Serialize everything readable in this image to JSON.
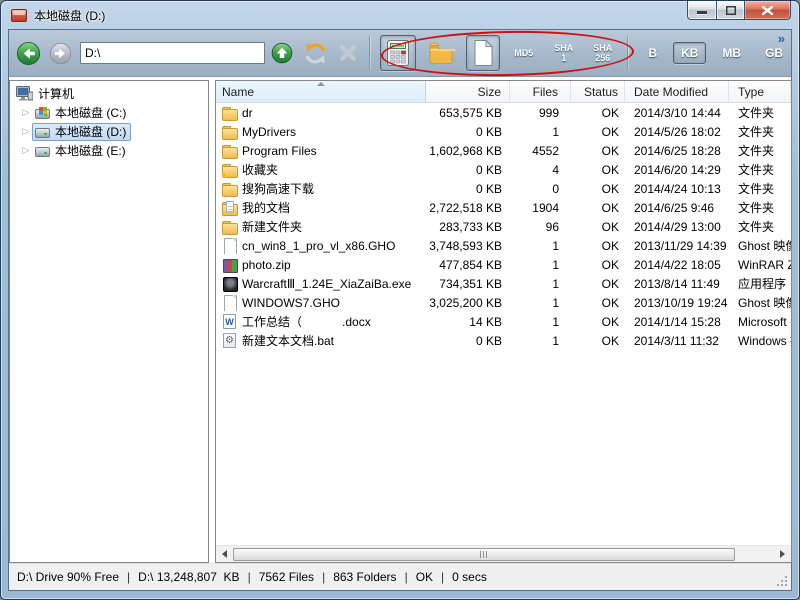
{
  "window": {
    "title": "本地磁盘 (D:)"
  },
  "toolbar": {
    "address": "D:\\",
    "hash": {
      "md5": "MD5",
      "sha1_line1": "SHA",
      "sha1_line2": "1",
      "sha256_line1": "SHA",
      "sha256_line2": "256"
    },
    "units": [
      "B",
      "KB",
      "MB",
      "GB"
    ],
    "selected_unit": "KB",
    "overflow_chevron": "»"
  },
  "sidebar": {
    "root": {
      "label": "计算机"
    },
    "items": [
      {
        "label": "本地磁盘 (C:)",
        "icon": "drive-windows",
        "selected": false
      },
      {
        "label": "本地磁盘 (D:)",
        "icon": "drive",
        "selected": true
      },
      {
        "label": "本地磁盘 (E:)",
        "icon": "drive",
        "selected": false
      }
    ]
  },
  "table": {
    "columns": [
      "Name",
      "Size",
      "Files",
      "Status",
      "Date Modified",
      "Type"
    ],
    "sorted_column": "Name",
    "sort_direction": "ascending",
    "rows": [
      {
        "icon": "folder",
        "name": "dr",
        "size": "653,575 KB",
        "files": "999",
        "status": "OK",
        "date": "2014/3/10 14:44",
        "type": "文件夹"
      },
      {
        "icon": "folder",
        "name": "MyDrivers",
        "size": "0 KB",
        "files": "1",
        "status": "OK",
        "date": "2014/5/26 18:02",
        "type": "文件夹"
      },
      {
        "icon": "folder",
        "name": "Program Files",
        "size": "1,602,968 KB",
        "files": "4552",
        "status": "OK",
        "date": "2014/6/25 18:28",
        "type": "文件夹"
      },
      {
        "icon": "folder-star",
        "name": "收藏夹",
        "size": "0 KB",
        "files": "4",
        "status": "OK",
        "date": "2014/6/20 14:29",
        "type": "文件夹"
      },
      {
        "icon": "folder",
        "name": "搜狗高速下载",
        "size": "0 KB",
        "files": "0",
        "status": "OK",
        "date": "2014/4/24 10:13",
        "type": "文件夹"
      },
      {
        "icon": "folder-docs",
        "name": "我的文档",
        "size": "2,722,518 KB",
        "files": "1904",
        "status": "OK",
        "date": "2014/6/25 9:46",
        "type": "文件夹"
      },
      {
        "icon": "folder",
        "name": "新建文件夹",
        "size": "283,733 KB",
        "files": "96",
        "status": "OK",
        "date": "2014/4/29 13:00",
        "type": "文件夹"
      },
      {
        "icon": "file",
        "name": "cn_win8_1_pro_vl_x86.GHO",
        "size": "3,748,593 KB",
        "files": "1",
        "status": "OK",
        "date": "2013/11/29 14:39",
        "type": "Ghost 映像"
      },
      {
        "icon": "winrar",
        "name": "photo.zip",
        "size": "477,854 KB",
        "files": "1",
        "status": "OK",
        "date": "2014/4/22 18:05",
        "type": "WinRAR Z"
      },
      {
        "icon": "warcraft",
        "name": "WarcraftⅢ_1.24E_XiaZaiBa.exe",
        "size": "734,351 KB",
        "files": "1",
        "status": "OK",
        "date": "2013/8/14 11:49",
        "type": "应用程序"
      },
      {
        "icon": "file",
        "name": "WINDOWS7.GHO",
        "size": "3,025,200 KB",
        "files": "1",
        "status": "OK",
        "date": "2013/10/19 19:24",
        "type": "Ghost 映像"
      },
      {
        "icon": "word",
        "name": "工作总结（            .docx",
        "size": "14 KB",
        "files": "1",
        "status": "OK",
        "date": "2014/1/14 15:28",
        "type": "Microsoft"
      },
      {
        "icon": "batch",
        "name": "新建文本文档.bat",
        "size": "0 KB",
        "files": "1",
        "status": "OK",
        "date": "2014/3/11 11:32",
        "type": "Windows 批"
      }
    ]
  },
  "statusbar": {
    "divider": "|",
    "segments": [
      "D:\\ Drive 90% Free",
      "D:\\ 13,248,807  KB",
      "7562 Files",
      "863 Folders",
      "OK",
      "0 secs"
    ]
  },
  "icons": {
    "expander": "▷",
    "star_glyph": "★",
    "word_glyph": "W",
    "batch_glyph": "⚙"
  },
  "colors": {
    "annotation_red": "#cc1111",
    "selection_border": "#7da2ce",
    "selection_fill": "#dcebfc",
    "folder_yellow": "#fde29b",
    "close_button_red": "#c2503a",
    "glass_blue": "#a2bcd6"
  }
}
